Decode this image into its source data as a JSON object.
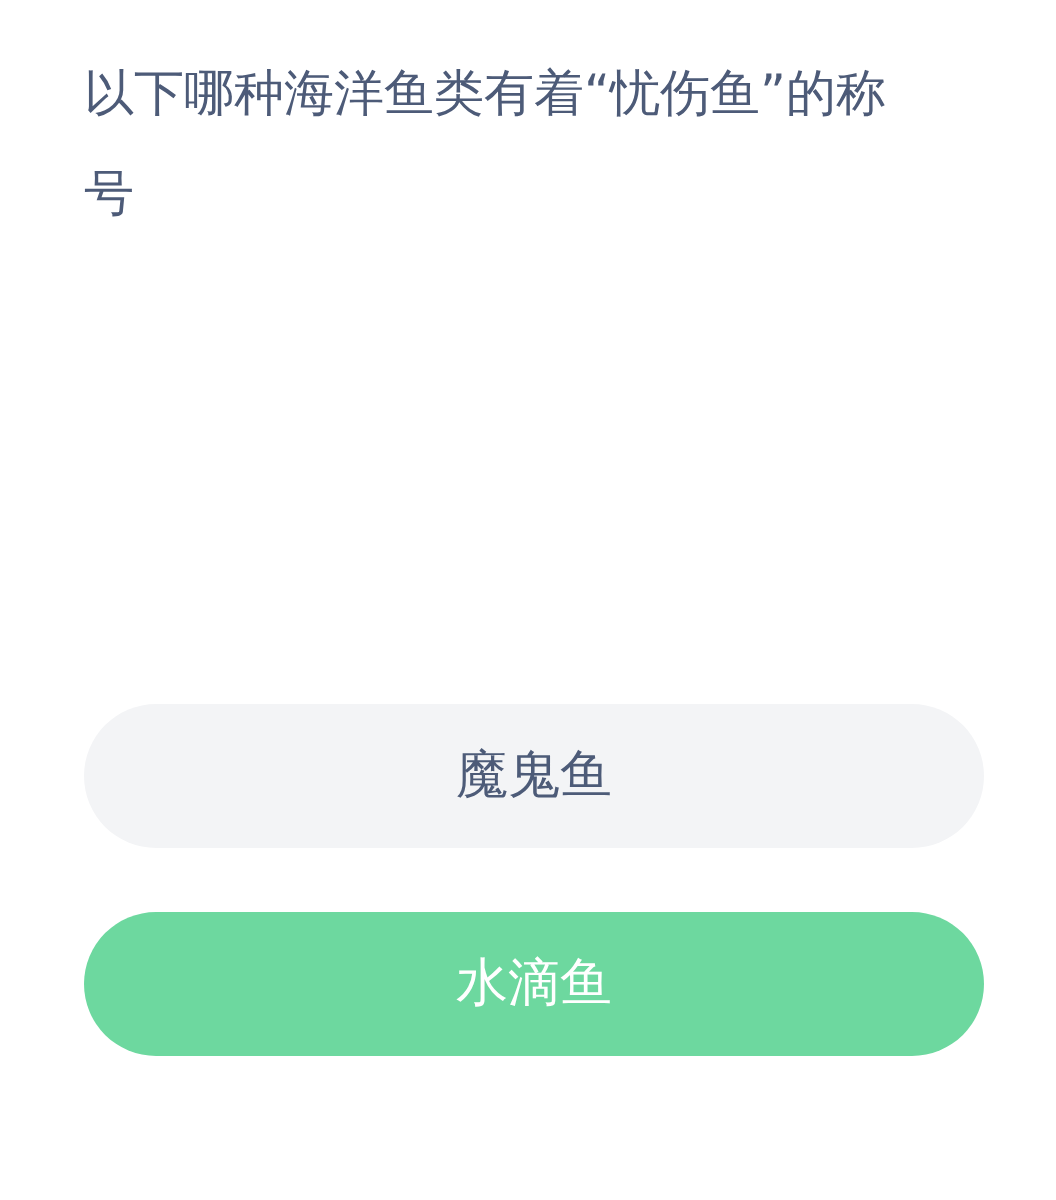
{
  "question": "以下哪种海洋鱼类有着“忧伤鱼”的称号",
  "options": [
    {
      "label": "魔鬼鱼",
      "selected": false
    },
    {
      "label": "水滴鱼",
      "selected": true
    }
  ]
}
